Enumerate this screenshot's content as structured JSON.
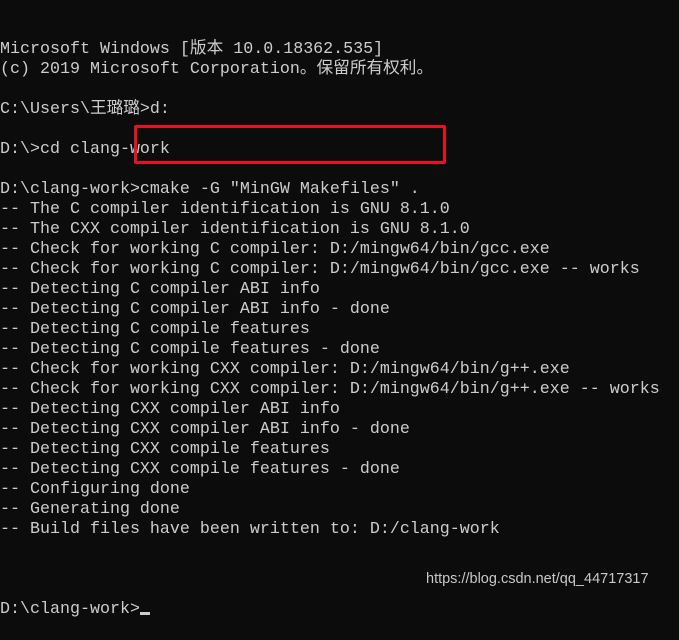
{
  "console": {
    "lines": [
      "Microsoft Windows [版本 10.0.18362.535]",
      "(c) 2019 Microsoft Corporation。保留所有权利。",
      "",
      "C:\\Users\\王璐璐>d:",
      "",
      "D:\\>cd clang-work",
      "",
      "D:\\clang-work>cmake -G \"MinGW Makefiles\" .",
      "-- The C compiler identification is GNU 8.1.0",
      "-- The CXX compiler identification is GNU 8.1.0",
      "-- Check for working C compiler: D:/mingw64/bin/gcc.exe",
      "-- Check for working C compiler: D:/mingw64/bin/gcc.exe -- works",
      "-- Detecting C compiler ABI info",
      "-- Detecting C compiler ABI info - done",
      "-- Detecting C compile features",
      "-- Detecting C compile features - done",
      "-- Check for working CXX compiler: D:/mingw64/bin/g++.exe",
      "-- Check for working CXX compiler: D:/mingw64/bin/g++.exe -- works",
      "-- Detecting CXX compiler ABI info",
      "-- Detecting CXX compiler ABI info - done",
      "-- Detecting CXX compile features",
      "-- Detecting CXX compile features - done",
      "-- Configuring done",
      "-- Generating done",
      "-- Build files have been written to: D:/clang-work",
      ""
    ],
    "prompt": "D:\\clang-work>"
  },
  "highlight_color": "#e81123",
  "watermark": "https://blog.csdn.net/qq_44717317",
  "colors": {
    "background": "#0c0c0c",
    "text": "#cccccc"
  }
}
